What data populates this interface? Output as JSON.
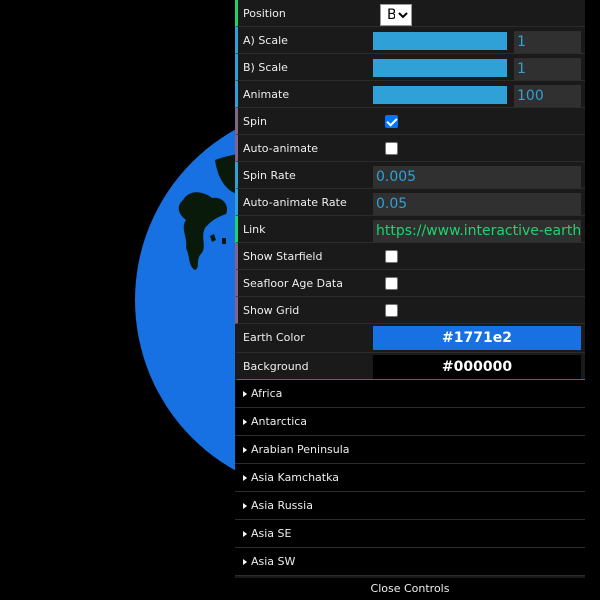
{
  "colors": {
    "earth": "#1771e2",
    "land": "#0a1a0a",
    "background": "#000000"
  },
  "controls": {
    "position": {
      "label": "Position",
      "selected": "B"
    },
    "a_scale": {
      "label": "A) Scale",
      "value": "1",
      "fraction": 1.0
    },
    "b_scale": {
      "label": "B) Scale",
      "value": "1",
      "fraction": 1.0
    },
    "animate": {
      "label": "Animate",
      "value": "100",
      "fraction": 1.0
    },
    "spin": {
      "label": "Spin",
      "checked": true
    },
    "auto_animate": {
      "label": "Auto-animate",
      "checked": false
    },
    "spin_rate": {
      "label": "Spin Rate",
      "value": "0.005"
    },
    "auto_animate_rate": {
      "label": "Auto-animate Rate",
      "value": "0.05"
    },
    "link": {
      "label": "Link",
      "value": "https://www.interactive-earth"
    },
    "show_starfield": {
      "label": "Show Starfield",
      "checked": false
    },
    "seafloor": {
      "label": "Seafloor Age Data",
      "checked": false
    },
    "show_grid": {
      "label": "Show Grid",
      "checked": false
    },
    "earth_color": {
      "label": "Earth Color",
      "value": "#1771e2"
    },
    "background": {
      "label": "Background",
      "value": "#000000"
    }
  },
  "folders": [
    {
      "label": "Africa"
    },
    {
      "label": "Antarctica"
    },
    {
      "label": "Arabian Peninsula"
    },
    {
      "label": "Asia Kamchatka"
    },
    {
      "label": "Asia Russia"
    },
    {
      "label": "Asia SE"
    },
    {
      "label": "Asia SW"
    }
  ],
  "close_label": "Close Controls"
}
